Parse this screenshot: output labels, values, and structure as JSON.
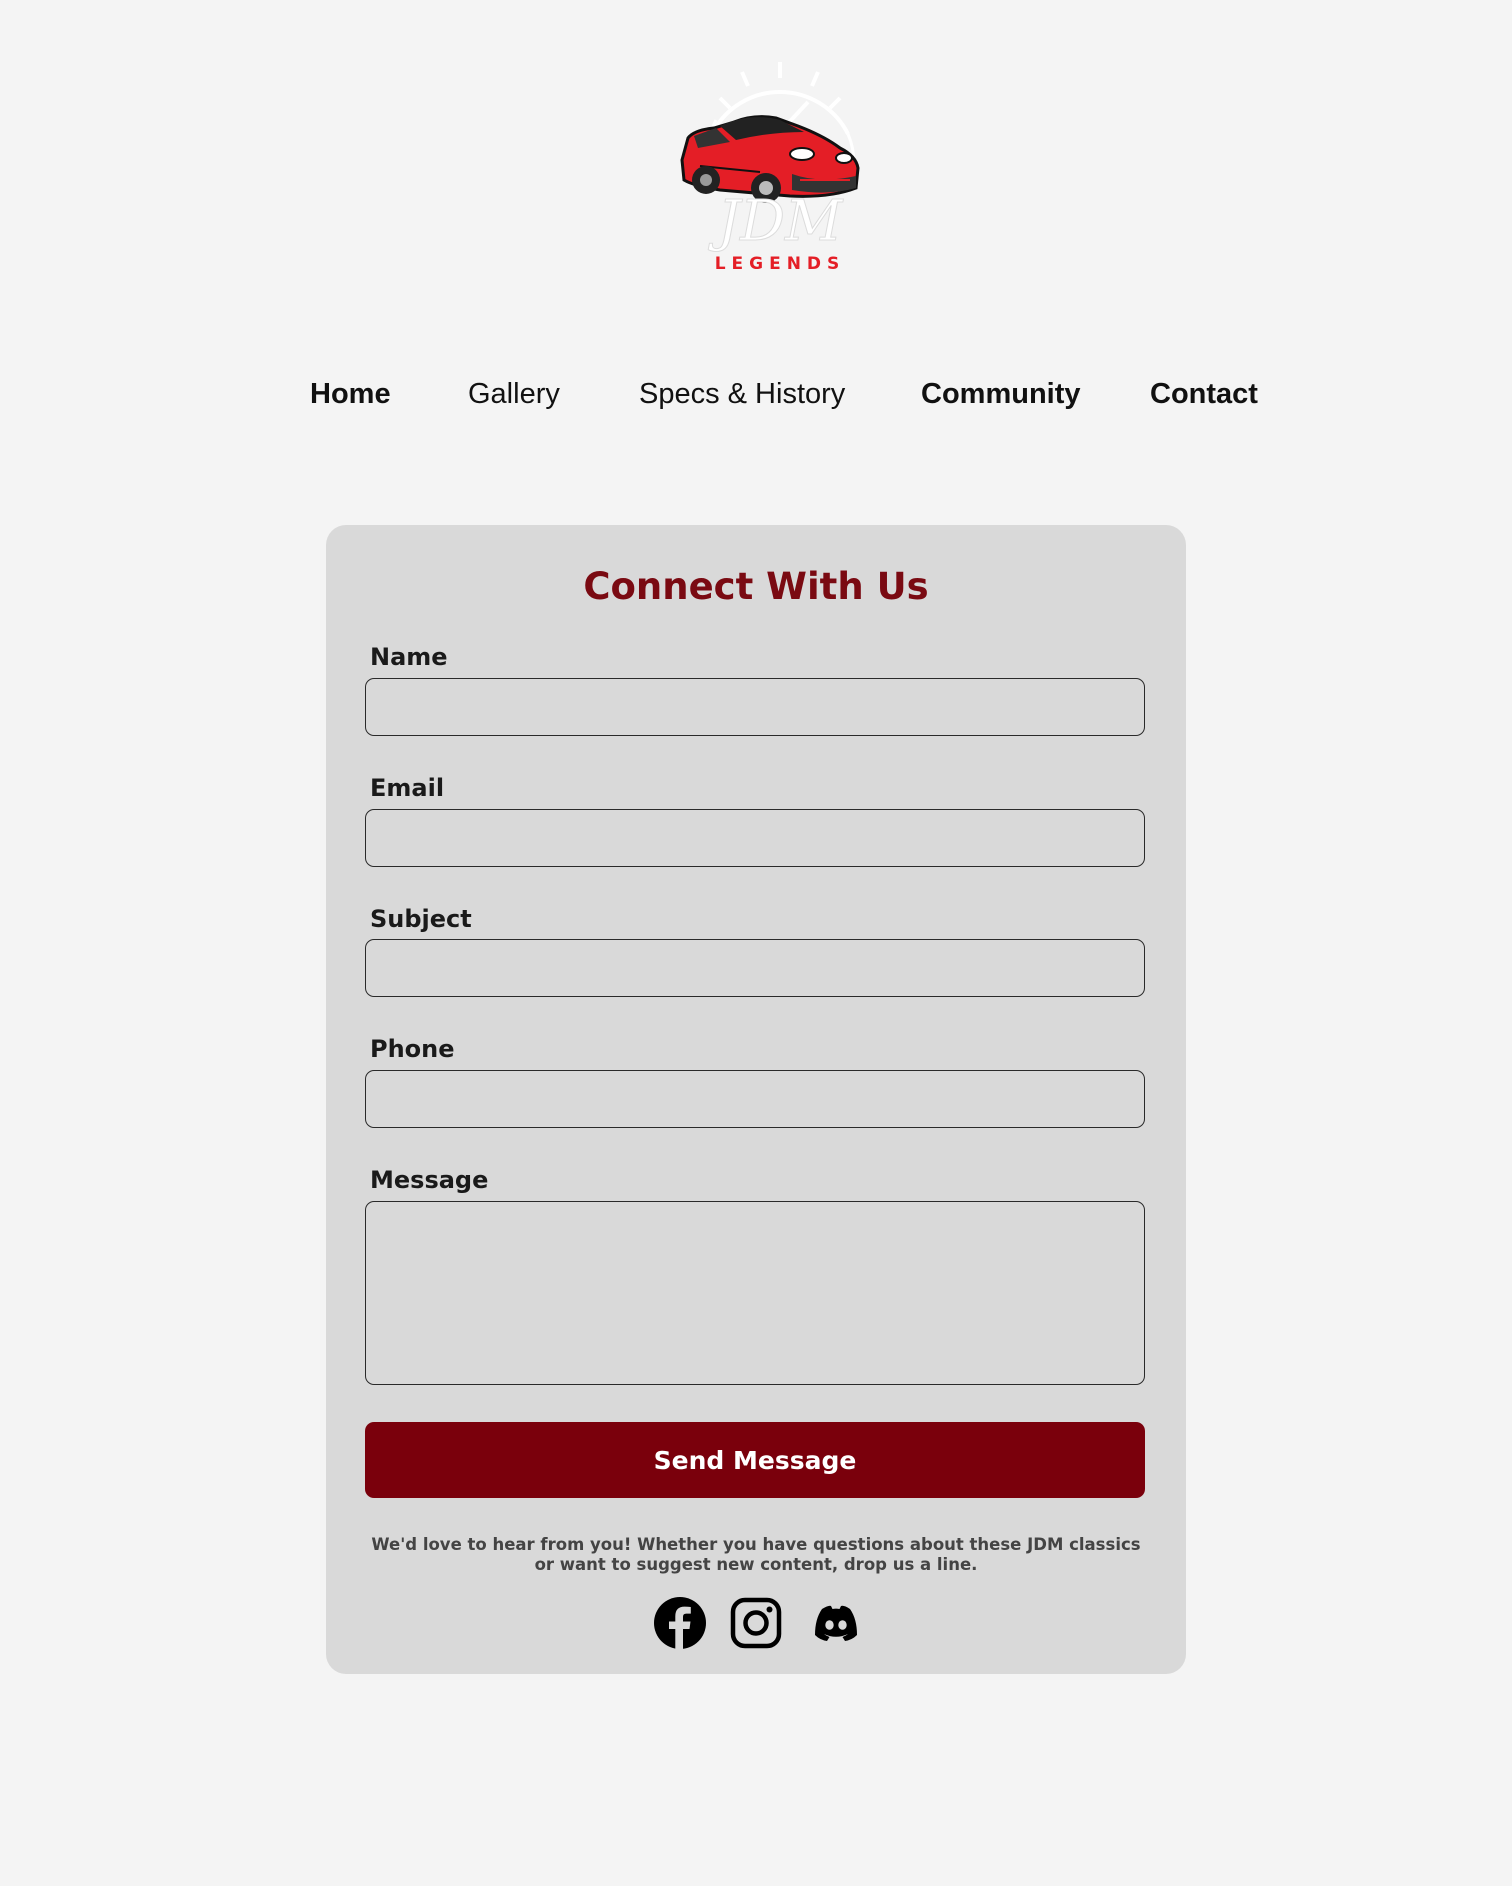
{
  "brand": {
    "logo_title": "JDM",
    "logo_subtitle": "LEGENDS",
    "logo_icon": "jdm-legends-car-logo"
  },
  "nav": {
    "items": [
      {
        "label": "Home"
      },
      {
        "label": "Gallery"
      },
      {
        "label": "Specs & History"
      },
      {
        "label": "Community"
      },
      {
        "label": "Contact"
      }
    ]
  },
  "contact_form": {
    "title": "Connect With Us",
    "fields": {
      "name": {
        "label": "Name",
        "value": ""
      },
      "email": {
        "label": "Email",
        "value": ""
      },
      "subject": {
        "label": "Subject",
        "value": ""
      },
      "phone": {
        "label": "Phone",
        "value": ""
      },
      "message": {
        "label": "Message",
        "value": ""
      }
    },
    "submit_label": "Send Message",
    "note": "We'd love to hear from you! Whether you have questions about these JDM classics or want to suggest new content, drop us a line."
  },
  "social": {
    "icons": [
      "facebook-icon",
      "instagram-icon",
      "discord-icon"
    ]
  },
  "colors": {
    "page_background": "#f4f4f4",
    "card_background": "#d9d9d9",
    "accent": "#7a000c",
    "title": "#7a0a12",
    "logo_red": "#e41e26"
  }
}
